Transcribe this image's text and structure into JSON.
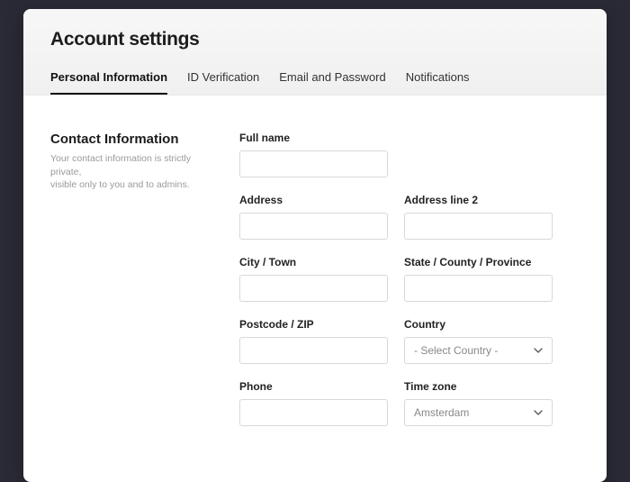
{
  "header": {
    "title": "Account settings",
    "tabs": [
      {
        "label": "Personal Information",
        "active": true
      },
      {
        "label": "ID Verification",
        "active": false
      },
      {
        "label": "Email and Password",
        "active": false
      },
      {
        "label": "Notifications",
        "active": false
      }
    ]
  },
  "section": {
    "title": "Contact Information",
    "desc_line1": "Your contact information is strictly private,",
    "desc_line2": "visible only to you and to admins."
  },
  "fields": {
    "full_name": {
      "label": "Full name",
      "value": ""
    },
    "address": {
      "label": "Address",
      "value": ""
    },
    "address2": {
      "label": "Address line 2",
      "value": ""
    },
    "city": {
      "label": "City / Town",
      "value": ""
    },
    "state": {
      "label": "State / County / Province",
      "value": ""
    },
    "postcode": {
      "label": "Postcode / ZIP",
      "value": ""
    },
    "country": {
      "label": "Country",
      "placeholder": "- Select Country -",
      "value": ""
    },
    "phone": {
      "label": "Phone",
      "value": ""
    },
    "timezone": {
      "label": "Time zone",
      "placeholder": "Amsterdam",
      "value": "Amsterdam"
    }
  }
}
